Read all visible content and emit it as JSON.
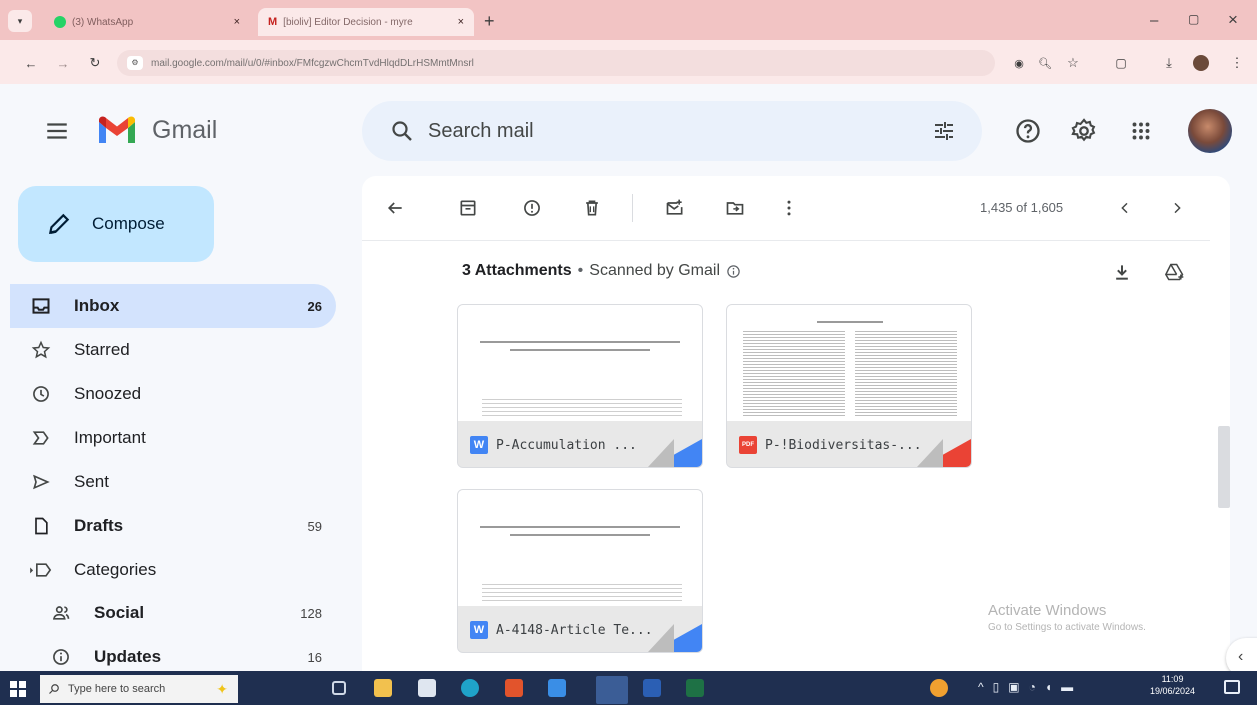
{
  "browser": {
    "tabs": [
      {
        "label": "(3) WhatsApp",
        "close": "×"
      },
      {
        "label": "[bioliv] Editor Decision - myre",
        "close": "×"
      }
    ],
    "new_tab": "+",
    "url": "mail.google.com/mail/u/0/#inbox/FMfcgzwChcmTvdHlqdDLrHSMmtMnsrl",
    "window_controls": {
      "minimize": "–",
      "maximize": "▢",
      "close": "×"
    }
  },
  "gmail": {
    "logo_text": "Gmail",
    "search_placeholder": "Search mail",
    "compose_label": "Compose",
    "nav": [
      {
        "label": "Inbox",
        "count": "26"
      },
      {
        "label": "Starred",
        "count": ""
      },
      {
        "label": "Snoozed",
        "count": ""
      },
      {
        "label": "Important",
        "count": ""
      },
      {
        "label": "Sent",
        "count": ""
      },
      {
        "label": "Drafts",
        "count": "59"
      },
      {
        "label": "Categories",
        "count": ""
      },
      {
        "label": "Social",
        "count": "128"
      },
      {
        "label": "Updates",
        "count": "16"
      }
    ],
    "pagination": "1,435 of 1,605",
    "attachments_title": "3 Attachments",
    "attachments_separator": "•",
    "scanned_label": "Scanned by Gmail",
    "attachments": [
      {
        "name": "P-Accumulation ...",
        "type": "W"
      },
      {
        "name": "P-!Biodiversitas-...",
        "type": "PDF"
      },
      {
        "name": "A-4148-Article Te...",
        "type": "W"
      }
    ],
    "colors": {
      "compose_bg": "#c2e7ff",
      "active_nav": "#d3e3fd",
      "word": "#4285f4",
      "pdf": "#ea4335"
    }
  },
  "watermark": {
    "title": "Activate Windows",
    "subtitle": "Go to Settings to activate Windows."
  },
  "taskbar": {
    "search_placeholder": "Type here to search",
    "time": "11:09",
    "date": "19/06/2024"
  }
}
